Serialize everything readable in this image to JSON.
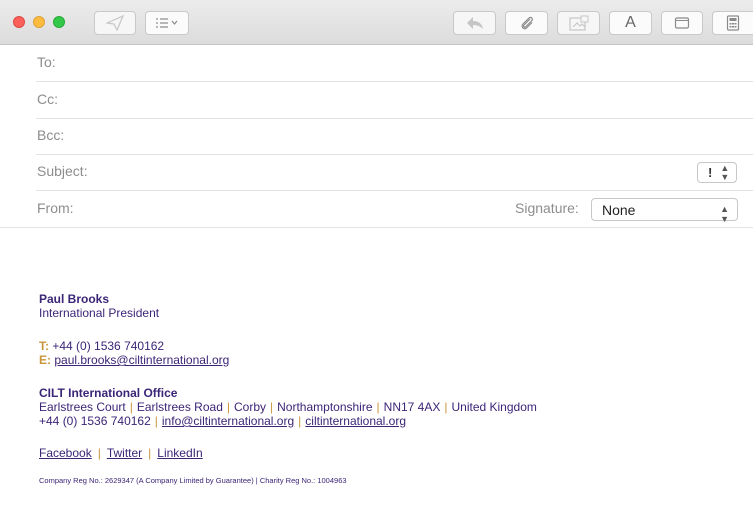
{
  "toolbar": {
    "buttons": [
      {
        "name": "send",
        "icon": "send-icon",
        "enabled": false
      },
      {
        "name": "header-fields",
        "icon": "list-icon",
        "enabled": true
      },
      {
        "name": "reply",
        "icon": "reply-icon",
        "enabled": false
      },
      {
        "name": "attach",
        "icon": "paperclip-icon",
        "enabled": true
      },
      {
        "name": "photo",
        "icon": "photo-icon",
        "enabled": false
      },
      {
        "name": "format",
        "icon": "font-icon",
        "enabled": true,
        "label": "A"
      },
      {
        "name": "window",
        "icon": "window-icon",
        "enabled": true
      },
      {
        "name": "markup",
        "icon": "calculator-icon",
        "enabled": true
      }
    ]
  },
  "fields": {
    "to_label": "To:",
    "cc_label": "Cc:",
    "bcc_label": "Bcc:",
    "subject_label": "Subject:",
    "from_label": "From:",
    "priority_value": "!",
    "signature_label": "Signature:",
    "signature_value": "None"
  },
  "signature": {
    "name": "Paul Brooks",
    "role": "International President",
    "phone_tag": "T:",
    "phone": "+44 (0) 1536 740162",
    "email_tag": "E:",
    "email": "paul.brooks@ciltinternational.org",
    "office_title": "CILT International Office",
    "address_parts": [
      "Earlstrees Court",
      "Earlstrees Road",
      "Corby",
      "Northamptonshire",
      "NN17 4AX",
      "United Kingdom"
    ],
    "office_phone": "+44 (0) 1536 740162",
    "office_email": "info@ciltinternational.org",
    "office_web": "ciltinternational.org",
    "social": [
      "Facebook",
      "Twitter",
      "LinkedIn"
    ],
    "footer": "Company Reg No.: 2629347 (A Company Limited by Guarantee) | Charity Reg No.: 1004963",
    "separator": "|"
  },
  "colors": {
    "signature_text": "#3b2577",
    "signature_accent": "#c8953a"
  }
}
